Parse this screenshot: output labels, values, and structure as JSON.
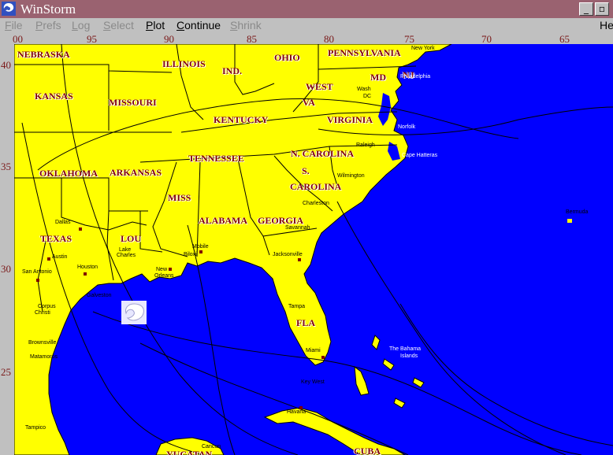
{
  "window": {
    "title": "WinStorm",
    "minimize": "_",
    "restore": "▫",
    "close": "✕"
  },
  "menu": {
    "file": {
      "first": "F",
      "rest": "ile"
    },
    "prefs": {
      "first": "P",
      "rest": "refs"
    },
    "log": {
      "first": "L",
      "rest": "og"
    },
    "select": {
      "first": "S",
      "rest": "elect"
    },
    "plot": {
      "first": "P",
      "rest": "lot"
    },
    "continue": {
      "first": "C",
      "rest": "ontinue"
    },
    "shrink": {
      "first": "S",
      "rest": "hrink"
    },
    "help": "He"
  },
  "longitudes": [
    "00",
    "95",
    "90",
    "85",
    "80",
    "75",
    "70",
    "65"
  ],
  "latitudes": [
    "40",
    "35",
    "30",
    "25"
  ],
  "states": {
    "nebraska": "NEBRASKA",
    "illinois": "ILLINOIS",
    "ohio": "OHIO",
    "pennsylvania": "PENNSYLVANIA",
    "ind": "IND.",
    "md": "MD",
    "nj": "NJ",
    "west": "WEST",
    "va": "VA",
    "kansas": "KANSAS",
    "missouri": "MISSOURI",
    "kentucky": "KENTUCKY",
    "virginia": "VIRGINIA",
    "ncarolina": "N. CAROLINA",
    "tennessee": "TENNESSEE",
    "oklahoma": "OKLAHOMA",
    "arkansas": "ARKANSAS",
    "s": "S.",
    "carolina": "CAROLINA",
    "miss": "MISS",
    "alabama": "ALABAMA",
    "georgia": "GEORGIA",
    "texas": "TEXAS",
    "lou": "LOU",
    "fla": "FLA",
    "cuba": "CUBA",
    "yucatan": "YUCATAN"
  },
  "cities": {
    "newyork": "New York",
    "philadelphia": "Philadelphia",
    "wash": "Wash",
    "dc": "DC",
    "norfolk": "Norfolk",
    "raleigh": "Raleigh",
    "capehatteras": "Cape Hatteras",
    "wilmington": "Wilmington",
    "charleston": "Charleston",
    "savannah": "Savannah",
    "jacksonville": "Jacksonville",
    "tampa": "Tampa",
    "miami": "Miami",
    "keywest": "Key West",
    "havana": "Havana",
    "bermuda": "Bermuda",
    "thebahama": "The Bahama",
    "islands": "Islands",
    "dallas": "Dallas",
    "austin": "Austin",
    "sanantonio": "San Antonio",
    "houston": "Houston",
    "galveston": "Galveston",
    "corpus": "Corpus",
    "christi": "Christi",
    "brownsville": "Brownsville",
    "matamoros": "Matamoros",
    "tampico": "Tampico",
    "lake": "Lake",
    "charles": "Charles",
    "neworleans1": "New",
    "neworleans2": "Orleans",
    "biloxi": "Biloxi",
    "mobile": "Mobile",
    "cancun": "Cancun"
  },
  "colors": {
    "land": "#ffff00",
    "ocean": "#0000ff",
    "title_bar": "#9a6270",
    "label": "#800000"
  }
}
